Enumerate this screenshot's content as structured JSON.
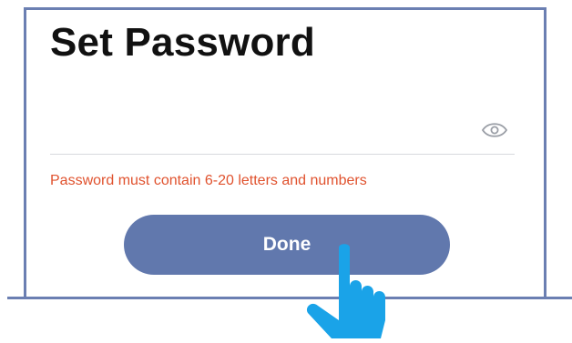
{
  "screen": {
    "title": "Set Password",
    "password_field": {
      "value": "",
      "placeholder": "",
      "visibility_icon": "eye-icon"
    },
    "error_message": "Password must contain 6-20 letters and numbers",
    "done_button_label": "Done",
    "pointer_icon": "pointing-hand-icon"
  },
  "colors": {
    "frame": "#6b7fb2",
    "button": "#6178ad",
    "error_text": "#e0522e",
    "hand": "#1aa3e8"
  }
}
